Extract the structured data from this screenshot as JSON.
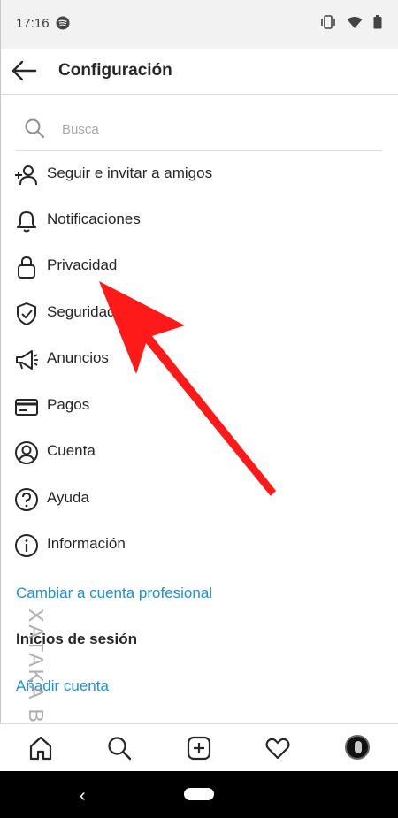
{
  "status_bar": {
    "time": "17:16",
    "icons": [
      "spotify-icon",
      "vibrate-icon",
      "wifi-icon",
      "battery-icon"
    ]
  },
  "header": {
    "title": "Configuración",
    "back_icon": "arrow-left-icon"
  },
  "search": {
    "placeholder": "Busca",
    "value": ""
  },
  "menu": [
    {
      "label": "Seguir e invitar a amigos",
      "icon": "add-person-icon"
    },
    {
      "label": "Notificaciones",
      "icon": "bell-icon"
    },
    {
      "label": "Privacidad",
      "icon": "lock-icon"
    },
    {
      "label": "Seguridad",
      "icon": "shield-check-icon"
    },
    {
      "label": "Anuncios",
      "icon": "megaphone-icon"
    },
    {
      "label": "Pagos",
      "icon": "credit-card-icon"
    },
    {
      "label": "Cuenta",
      "icon": "account-circle-icon"
    },
    {
      "label": "Ayuda",
      "icon": "help-circle-icon"
    },
    {
      "label": "Información",
      "icon": "info-circle-icon"
    }
  ],
  "links": {
    "switch_account": "Cambiar a cuenta profesional",
    "add_account": "Añadir cuenta"
  },
  "sections": {
    "logins": "Inicios de sesión"
  },
  "tab_bar": {
    "tabs": [
      "home-icon",
      "search-icon",
      "new-post-icon",
      "activity-heart-icon",
      "profile-avatar"
    ]
  },
  "nav_bar": {
    "back_glyph": "‹"
  },
  "watermark": {
    "text": "XATAKA BASICS"
  },
  "colors": {
    "link": "#1f8fd6",
    "arrow": "#ff1a1a",
    "text": "#262626"
  }
}
